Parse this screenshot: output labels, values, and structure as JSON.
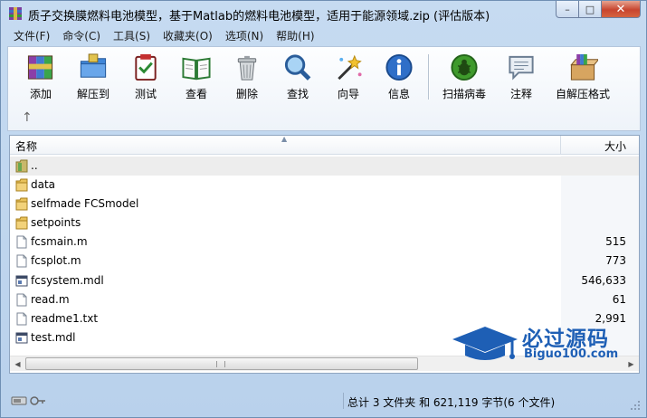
{
  "window": {
    "title": "质子交换膜燃料电池模型，基于Matlab的燃料电池模型，适用于能源领域.zip (评估版本)",
    "controls": {
      "minimize": "–",
      "maximize": "□",
      "close": "✕"
    }
  },
  "menu": [
    {
      "label": "文件(F)"
    },
    {
      "label": "命令(C)"
    },
    {
      "label": "工具(S)"
    },
    {
      "label": "收藏夹(O)"
    },
    {
      "label": "选项(N)"
    },
    {
      "label": "帮助(H)"
    }
  ],
  "toolbar": {
    "buttons": [
      {
        "label": "添加",
        "icon": "add-archive-icon"
      },
      {
        "label": "解压到",
        "icon": "extract-to-icon"
      },
      {
        "label": "测试",
        "icon": "test-icon"
      },
      {
        "label": "查看",
        "icon": "view-icon"
      },
      {
        "label": "删除",
        "icon": "delete-icon"
      },
      {
        "label": "查找",
        "icon": "find-icon"
      },
      {
        "label": "向导",
        "icon": "wizard-icon"
      },
      {
        "label": "信息",
        "icon": "info-icon"
      },
      {
        "label": "扫描病毒",
        "icon": "virus-scan-icon"
      },
      {
        "label": "注释",
        "icon": "comment-icon"
      },
      {
        "label": "自解压格式",
        "icon": "sfx-icon"
      }
    ],
    "up_arrow": "↑"
  },
  "file_list": {
    "columns": {
      "name": "名称",
      "size": "大小"
    },
    "sort_indicator": "▲",
    "rows": [
      {
        "name": "..",
        "size": "",
        "type": "parent"
      },
      {
        "name": "data",
        "size": "",
        "type": "folder"
      },
      {
        "name": "selfmade FCSmodel",
        "size": "",
        "type": "folder"
      },
      {
        "name": "setpoints",
        "size": "",
        "type": "folder"
      },
      {
        "name": "fcsmain.m",
        "size": "515",
        "type": "file"
      },
      {
        "name": "fcsplot.m",
        "size": "773",
        "type": "file"
      },
      {
        "name": "fcsystem.mdl",
        "size": "546,633",
        "type": "mdl"
      },
      {
        "name": "read.m",
        "size": "61",
        "type": "file"
      },
      {
        "name": "readme1.txt",
        "size": "2,991",
        "type": "file"
      },
      {
        "name": "test.mdl",
        "size": "",
        "type": "mdl"
      }
    ]
  },
  "watermark": {
    "main": "必过源码",
    "sub": "Biguo100.com"
  },
  "status": {
    "summary": "总计 3 文件夹 和 621,119 字节(6 个文件)"
  },
  "colors": {
    "accent": "#1e5fb5",
    "window_bg": "#c6dbf1",
    "close_red": "#c8452f"
  }
}
